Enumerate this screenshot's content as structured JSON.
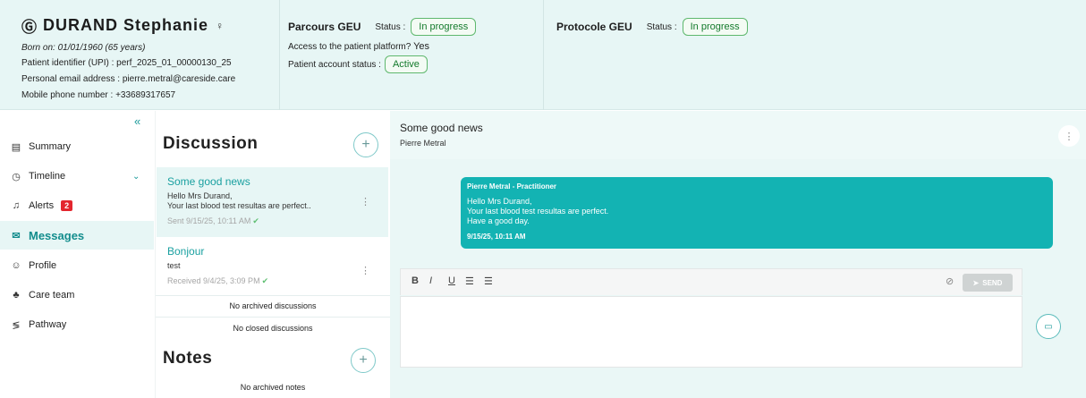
{
  "patient": {
    "name": "DURAND Stephanie",
    "born": "Born on: 01/01/1960 (65 years)",
    "upi_label": "Patient identifier (UPI) :",
    "upi_value": "perf_2025_01_00000130_25",
    "email_label": "Personal email address :",
    "email_value": "pierre.metral@careside.care",
    "phone_label": "Mobile phone number :",
    "phone_value": "+33689317657"
  },
  "parcours": {
    "title": "Parcours GEU",
    "status_label": "Status :",
    "status": "In progress",
    "access_label": "Access to the patient platform?",
    "access_value": "Yes",
    "account_label": "Patient account status :",
    "account_status": "Active"
  },
  "protocole": {
    "title": "Protocole GEU",
    "status_label": "Status :",
    "status": "In progress"
  },
  "sidebar": {
    "collapse_glyph": "«",
    "items": [
      {
        "label": "Summary"
      },
      {
        "label": "Timeline"
      },
      {
        "label": "Alerts",
        "badge": "2"
      },
      {
        "label": "Messages"
      },
      {
        "label": "Profile"
      },
      {
        "label": "Care team"
      },
      {
        "label": "Pathway"
      }
    ]
  },
  "discussion": {
    "title": "Discussion",
    "threads": [
      {
        "title": "Some good news",
        "line1": "Hello Mrs Durand,",
        "line2": "Your last blood test resultas are perfect..",
        "meta": "Sent 9/15/25, 10:11 AM"
      },
      {
        "title": "Bonjour",
        "line1": "test",
        "meta": "Received 9/4/25, 3:09 PM"
      }
    ],
    "no_archived": "No archived discussions",
    "no_closed": "No closed discussions"
  },
  "notes": {
    "title": "Notes",
    "no_archived": "No archived notes"
  },
  "conversation": {
    "title": "Some good news",
    "subtitle": "Pierre Metral",
    "message": {
      "author": "Pierre Metral - Practitioner",
      "line1": "Hello Mrs Durand,",
      "line2": "Your last blood test resultas are perfect.",
      "line3": "Have a good day.",
      "time": "9/15/25, 10:11 AM"
    },
    "send_label": "SEND"
  },
  "colors": {
    "accent": "#13b3b3",
    "header_bg": "#e7f6f5",
    "status_green": "#137a2b",
    "alert_red": "#e3262e"
  }
}
